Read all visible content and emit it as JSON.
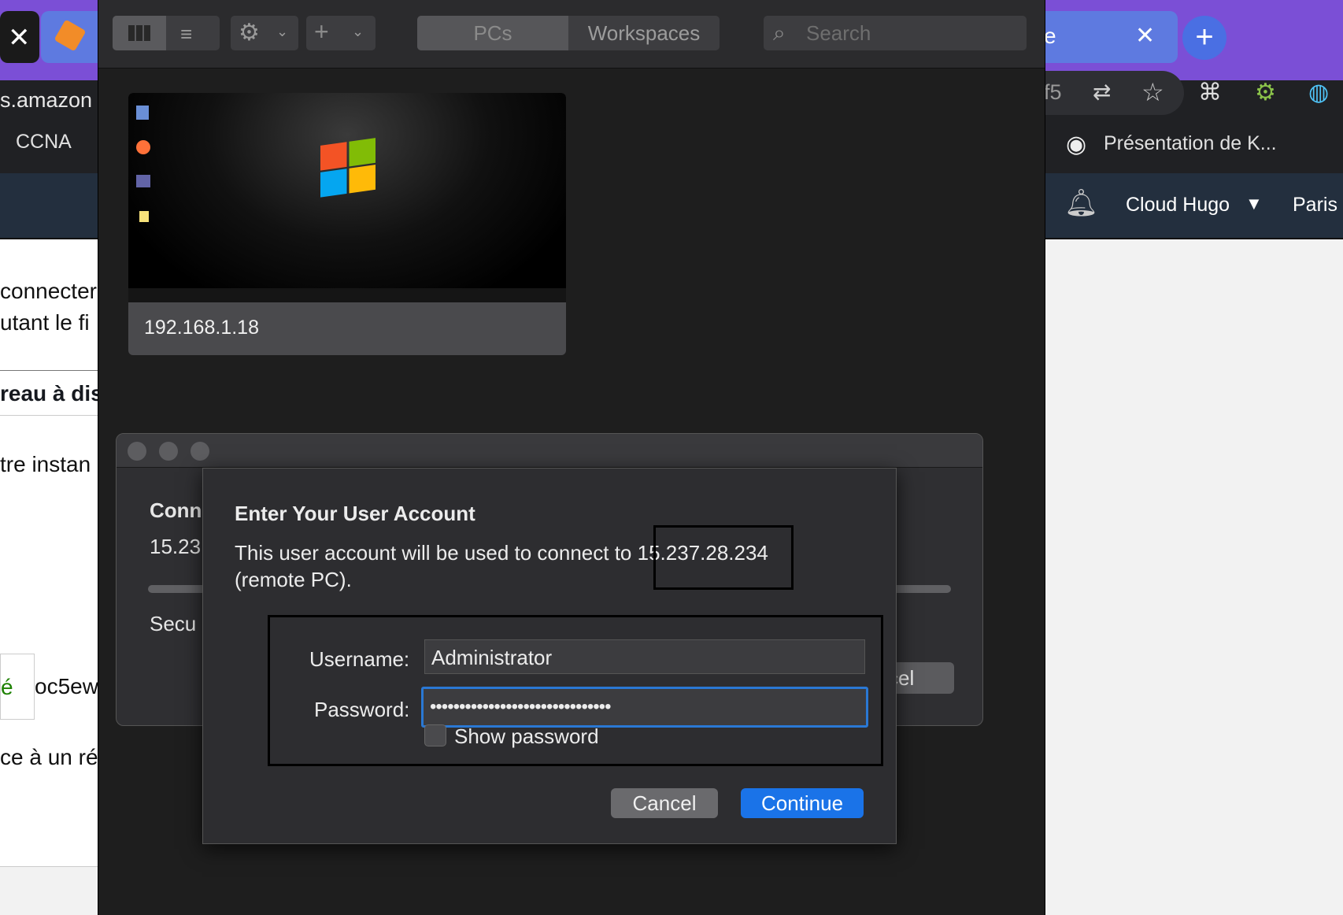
{
  "left_browser": {
    "address_fragment": "s.amazon",
    "bookmark": "CCNA",
    "line1": "connecter",
    "line2": "utant le fi",
    "section_heading": "reau à dis",
    "line3": "tre instan",
    "toast_check": "é",
    "line4": "oc5ew",
    "line5": "ce à un rép"
  },
  "right_browser": {
    "tab_fragment": "e",
    "addr_fragment": "f5",
    "bookmark": "Présentation de K...",
    "account": "Cloud Hugo",
    "region": "Paris"
  },
  "app": {
    "segments": {
      "pcs": "PCs",
      "workspaces": "Workspaces"
    },
    "search_placeholder": "Search",
    "pc_name": "192.168.1.18"
  },
  "connection_dialog": {
    "title_fragment": "Conn",
    "ip_fragment": "15.23",
    "security_fragment": "Secu",
    "cancel_fragment": "cel"
  },
  "sheet": {
    "title": "Enter Your User Account",
    "message_part1": "This user account will be used to connect to",
    "ip": "15.237.28.234",
    "message_part2": "(remote PC).",
    "username_label": "Username:",
    "username_value": "Administrator",
    "password_label": "Password:",
    "password_mask": "•••••••••••••••••••••••••••••••",
    "show_password_label": "Show password",
    "show_password_checked": false,
    "cancel_label": "Cancel",
    "continue_label": "Continue"
  },
  "colors": {
    "accent": "#1a73e8",
    "aws_nav": "#232f3e",
    "tab_bar": "#7b4fd6"
  }
}
